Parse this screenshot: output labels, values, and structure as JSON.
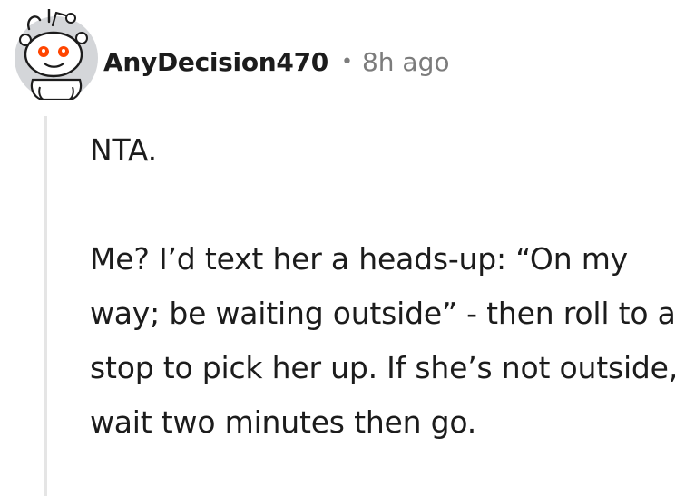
{
  "comment": {
    "author": "AnyDecision470",
    "separator": "•",
    "timestamp": "8h ago",
    "avatar_icon": "reddit-snoo-avatar-icon",
    "paragraphs": [
      "NTA.",
      "Me? I’d text her a heads-up: “On my way; be waiting outside” - then roll to a stop to pick her up. If she’s not outside, wait two minutes then go."
    ]
  },
  "colors": {
    "avatar_bg": "#d4d6d9",
    "text": "#1c1c1c",
    "muted": "#7c7c7c",
    "thread_line": "#e5e5e5"
  }
}
